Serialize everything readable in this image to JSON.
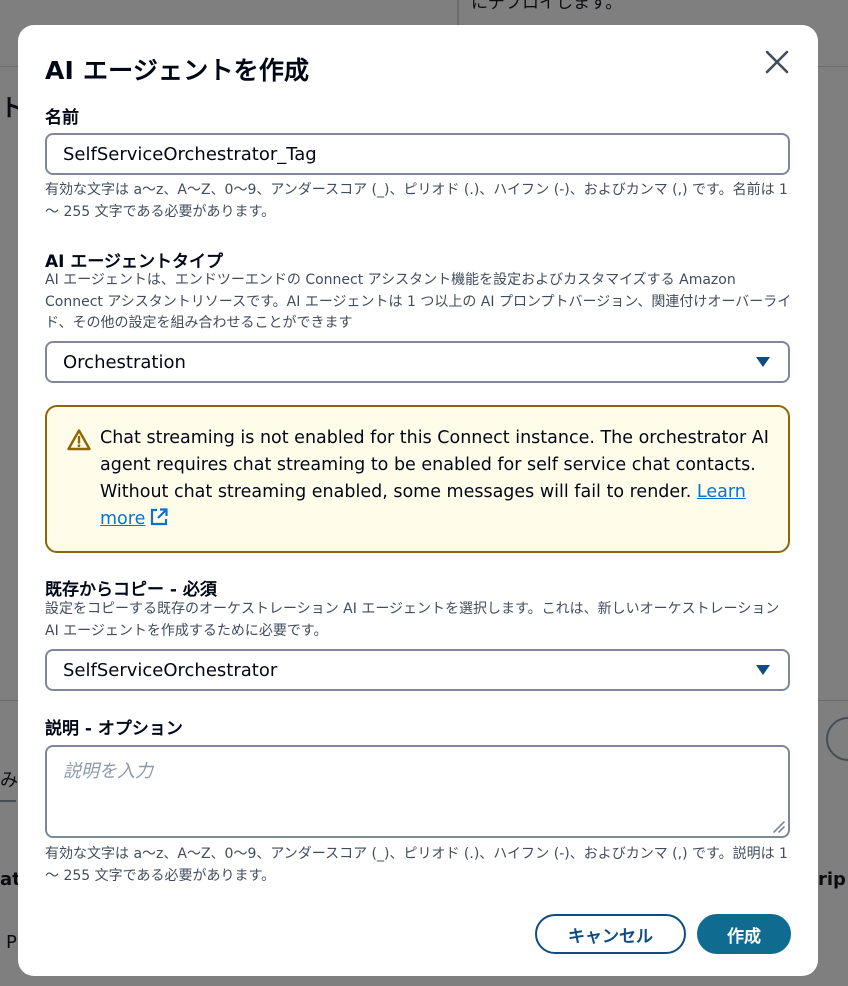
{
  "background": {
    "top_text": "にデプロイします。",
    "left_char_1": "ト",
    "left_char_2": "み",
    "left_char_3": "at",
    "left_char_4": "P",
    "right_text": "rip"
  },
  "modal": {
    "title": "AI エージェントを作成",
    "name_field": {
      "label": "名前",
      "value": "SelfServiceOrchestrator_Tag",
      "hint": "有効な文字は a〜z、A〜Z、0〜9、アンダースコア (_)、ピリオド (.)、ハイフン (-)、およびカンマ (,) です。名前は 1 〜 255 文字である必要があります。"
    },
    "type_field": {
      "label": "AI エージェントタイプ",
      "description": "AI エージェントは、エンドツーエンドの Connect アシスタント機能を設定およびカスタマイズする Amazon Connect アシスタントリソースです。AI エージェントは 1 つ以上の AI プロンプトバージョン、関連付けオーバーライド、その他の設定を組み合わせることができます",
      "selected": "Orchestration"
    },
    "alert": {
      "message": "Chat streaming is not enabled for this Connect instance. The orchestrator AI agent requires chat streaming to be enabled for self service chat contacts. Without chat streaming enabled, some messages will fail to render.",
      "link_text": "Learn more"
    },
    "copy_field": {
      "label": "既存からコピー - 必須",
      "description": "設定をコピーする既存のオーケストレーション AI エージェントを選択します。これは、新しいオーケストレーション AI エージェントを作成するために必要です。",
      "selected": "SelfServiceOrchestrator"
    },
    "description_field": {
      "label": "説明 - オプション",
      "placeholder": "説明を入力",
      "hint": "有効な文字は a〜z、A〜Z、0〜9、アンダースコア (_)、ピリオド (.)、ハイフン (-)、およびカンマ (,) です。説明は 1 〜 255 文字である必要があります。"
    },
    "cancel_label": "キャンセル",
    "create_label": "作成"
  },
  "colors": {
    "primary": "#0f6b8f",
    "warning_border": "#8d6605",
    "warning_bg": "#fffce9",
    "link": "#0972d3"
  }
}
